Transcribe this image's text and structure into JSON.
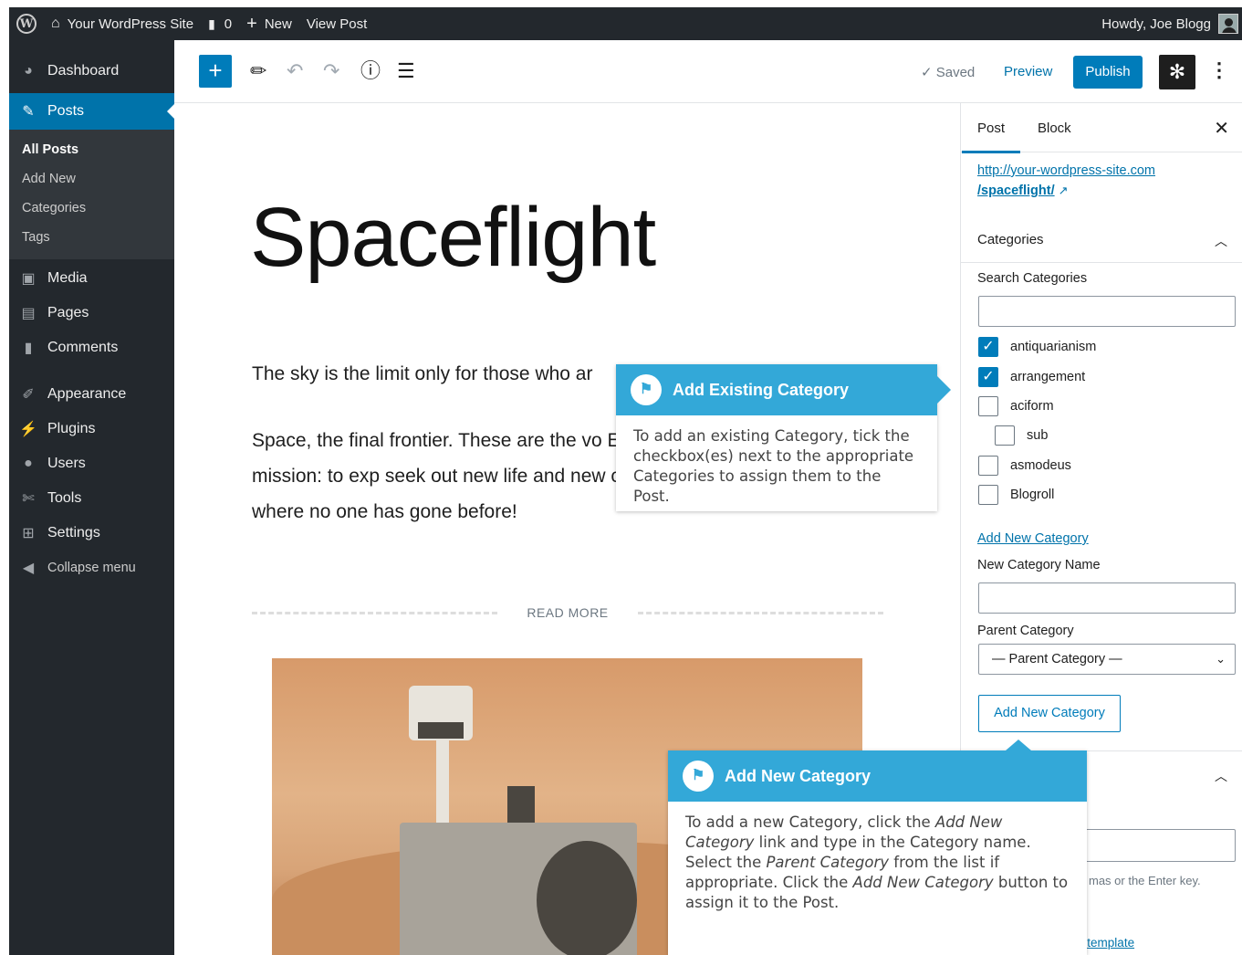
{
  "admin_bar": {
    "site_name": "Your WordPress Site",
    "comments_count": "0",
    "new_label": "New",
    "view_post_label": "View Post",
    "howdy": "Howdy, Joe Blogg"
  },
  "sidebar": {
    "items": [
      {
        "label": "Dashboard",
        "icon": "dashboard-icon"
      },
      {
        "label": "Posts",
        "icon": "pushpin-icon"
      },
      {
        "label": "Media",
        "icon": "media-icon"
      },
      {
        "label": "Pages",
        "icon": "pages-icon"
      },
      {
        "label": "Comments",
        "icon": "comment-icon"
      },
      {
        "label": "Appearance",
        "icon": "brush-icon"
      },
      {
        "label": "Plugins",
        "icon": "plug-icon"
      },
      {
        "label": "Users",
        "icon": "user-icon"
      },
      {
        "label": "Tools",
        "icon": "wrench-icon"
      },
      {
        "label": "Settings",
        "icon": "settings-icon"
      },
      {
        "label": "Collapse menu",
        "icon": "collapse-icon"
      }
    ],
    "submenu": [
      "All Posts",
      "Add New",
      "Categories",
      "Tags"
    ]
  },
  "toolbar": {
    "saved_label": "✓ Saved",
    "preview_label": "Preview",
    "publish_label": "Publish"
  },
  "editor": {
    "title": "Spaceflight",
    "paragraph1": "The sky is the limit only for those who ar",
    "paragraph2": "Space, the final frontier. These are the vo Enterprise. Its continuing mission: to exp seek out new life and new civilizations. To boldly go where no one has gone before!",
    "read_more": "READ MORE"
  },
  "panel": {
    "tab_post": "Post",
    "tab_block": "Block",
    "permalink_line1": "http://your-wordpress-site.com",
    "permalink_line2": "/spaceflight/",
    "categories_heading": "Categories",
    "search_label": "Search Categories",
    "categories": [
      {
        "name": "antiquarianism",
        "checked": true
      },
      {
        "name": "arrangement",
        "checked": true
      },
      {
        "name": "aciform",
        "checked": false
      },
      {
        "name": "sub",
        "checked": false
      },
      {
        "name": "asmodeus",
        "checked": false
      },
      {
        "name": "Blogroll",
        "checked": false
      }
    ],
    "add_new_link": "Add New Category",
    "new_name_label": "New Category Name",
    "parent_label": "Parent Category",
    "parent_select": "— Parent Category —",
    "add_button": "Add New Category",
    "tags_help": "mas or the Enter key.",
    "template_link_a": "ent",
    "template_link_b": "template"
  },
  "callout_existing": {
    "title": "Add Existing Category",
    "body": "To add an existing Category, tick the checkbox(es) next to the appropriate Categories to assign them to the Post."
  },
  "callout_new": {
    "title": "Add New Category",
    "b1": "To add a new Category, click the ",
    "i1": "Add New Category",
    "b2": " link and type in the Category name. Select the ",
    "i2": "Parent Category",
    "b3": " from the list if appropriate. Click the ",
    "i3": "Add New Category",
    "b4": " button to assign it to the Post."
  },
  "colors": {
    "admin_dark": "#23282d",
    "accent_blue": "#007cba",
    "callout_blue": "#33a8d8"
  }
}
